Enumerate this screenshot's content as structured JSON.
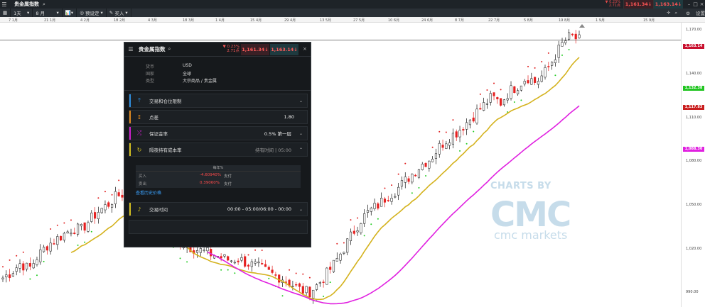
{
  "app": {
    "title": "贵金属指数",
    "change_pct": "▼ 0.23%",
    "change_abs": "2.71点",
    "sell_price": "1,161.34",
    "buy_price": "1,163.14",
    "sell_color": "#ff5555",
    "buy_color": "#ff5555"
  },
  "toolbar": {
    "interval": "1天",
    "period": "8 月",
    "preset": "预设定",
    "buy": "买入",
    "settings": "设置"
  },
  "time_axis": [
    "7 1月",
    "21 1月",
    "4 2月",
    "18 2月",
    "4 3月",
    "18 3月",
    "1 4月",
    "15 4月",
    "29 4月",
    "13 5月",
    "27 5月",
    "10 6月",
    "24 6月",
    "8 7月",
    "22 7月",
    "5 8月",
    "19 8月",
    "1 9月",
    "15 9月"
  ],
  "price_scale": {
    "ticks": [
      "1,170.00",
      "1,140.00",
      "1,110.00",
      "1,080.00",
      "1,050.00",
      "1,020.00",
      "990.00"
    ],
    "current_price": "1,163.14",
    "green_tag": "1,132.38",
    "yellow_tag": "1,117.83",
    "magenta_tag": "1,088.30"
  },
  "panel": {
    "title": "贵金属指数",
    "change_pct": "▼ 0.23%",
    "change_abs": "2.71点",
    "sell_price": "1,161.34",
    "buy_price": "1,163.14",
    "info": [
      {
        "key": "货币",
        "value": "USD"
      },
      {
        "key": "国家",
        "value": "全球"
      },
      {
        "key": "类型",
        "value": "大宗商品 / 贵金属"
      }
    ],
    "sections": {
      "trading": "交易和仓位限制",
      "spread_label": "点差",
      "spread_value": "1.80",
      "margin_label": "保证金率",
      "margin_value": "0.5% 第一层",
      "holding_label": "隔夜持有成本率",
      "holding_time": "持有时间 | 05:00",
      "hours_label": "交易时间",
      "hours_value": "00:00 - 05:00/06:00 - 00:00"
    },
    "financing": {
      "header": "每年%",
      "buy_label": "买入",
      "buy_rate": "-4.60940%",
      "buy_type": "支付",
      "sell_label": "卖出",
      "sell_rate": "0.39060%",
      "sell_type": "支付"
    },
    "history_link": "查看历史价格"
  },
  "watermark": {
    "top": "CHARTS BY",
    "logo": "CMC",
    "bottom": "cmc markets"
  },
  "colors": {
    "up": "#1fb31f",
    "down": "#e52020",
    "ma_yellow": "#d4b21d",
    "ma_magenta": "#e020e0",
    "psar_up": "#22cc22",
    "psar_down": "#e02020"
  },
  "chart_data": {
    "type": "candlestick",
    "title": "贵金属指数",
    "ylim": [
      980,
      1175
    ],
    "y_ticks": [
      990,
      1020,
      1050,
      1080,
      1110,
      1140,
      1170
    ],
    "current_price": 1163.14,
    "close_path": [
      1000,
      1004,
      1010,
      1006,
      1015,
      1022,
      1026,
      1030,
      1034,
      1033,
      1040,
      1046,
      1050,
      1056,
      1058,
      1054,
      1048,
      1042,
      1036,
      1030,
      1026,
      1022,
      1020,
      1018,
      1016,
      1014,
      1012,
      1013,
      1010,
      1008,
      1005,
      1002,
      1000,
      996,
      992,
      990,
      995,
      1002,
      1010,
      1020,
      1030,
      1040,
      1046,
      1050,
      1056,
      1060,
      1066,
      1072,
      1078,
      1082,
      1090,
      1096,
      1100,
      1106,
      1112,
      1118,
      1124,
      1120,
      1128,
      1132,
      1138,
      1134,
      1140,
      1150,
      1160,
      1166,
      1163
    ]
  }
}
